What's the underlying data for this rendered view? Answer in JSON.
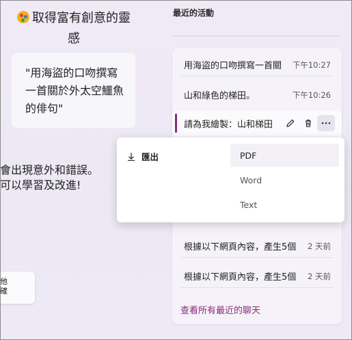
{
  "left": {
    "title": "取得富有創意的靈感",
    "prompt_card": "\"用海盜的口吻撰寫一首關於外太空鱷魚的俳句\"",
    "disclaimer": "會出現意外和錯誤。\n可以學習及改進!",
    "small_card": "他\n確"
  },
  "recent": {
    "heading": "最近的活動",
    "items": [
      {
        "label": "用海盜的口吻撰寫一首關",
        "time": "下午10:27"
      },
      {
        "label": "山和綠色的梯田。",
        "time": "下午10:26"
      },
      {
        "label": "請為我繪製：山和梯田",
        "time": ""
      },
      {
        "label": "根據以下網頁內容，產生5個",
        "time": "2 天前"
      },
      {
        "label": "根據以下網頁內容，產生5個",
        "time": "2 天前"
      }
    ],
    "see_all": "查看所有最近的聊天"
  },
  "export_menu": {
    "label": "匯出",
    "options": [
      "PDF",
      "Word",
      "Text"
    ],
    "highlighted": "PDF"
  },
  "icons": [
    "palette-icon",
    "pencil-icon",
    "trash-icon",
    "more-icon",
    "download-icon"
  ],
  "colors": {
    "accent": "#8a2b74",
    "background": "#efeaf6"
  }
}
